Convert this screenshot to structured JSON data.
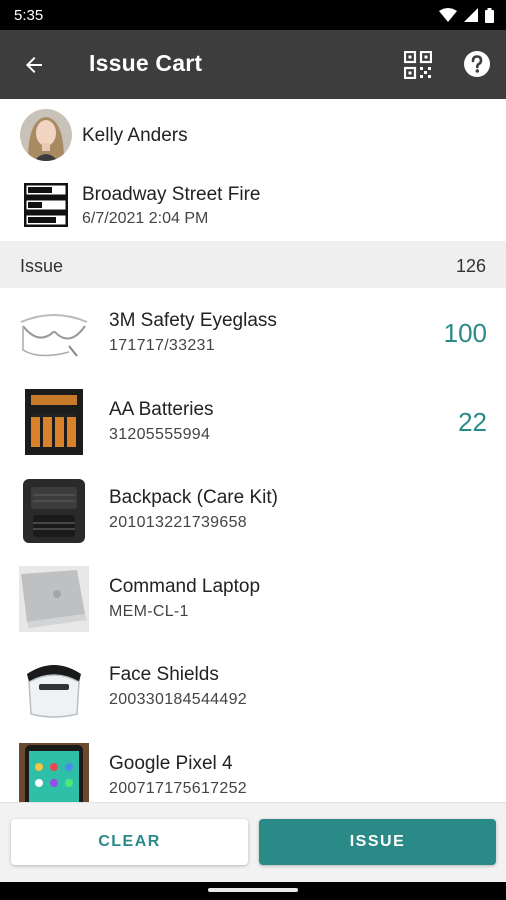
{
  "status_bar": {
    "time": "5:35",
    "icons": [
      "wifi-icon",
      "cellular-icon",
      "battery-icon"
    ]
  },
  "app_bar": {
    "title": "Issue Cart",
    "icons": [
      "back-arrow-icon",
      "qr-code-icon",
      "help-icon"
    ]
  },
  "user": {
    "name": "Kelly Anders"
  },
  "location": {
    "name": "Broadway Street Fire",
    "date": "6/7/2021 2:04 PM"
  },
  "section": {
    "label": "Issue",
    "count": "126"
  },
  "items": [
    {
      "name": "3M Safety Eyeglass",
      "code": "171717/33231",
      "qty": "100",
      "thumb": "safety-glasses-image"
    },
    {
      "name": "AA Batteries",
      "code": "31205555994",
      "qty": "22",
      "thumb": "batteries-image"
    },
    {
      "name": "Backpack (Care Kit)",
      "code": "201013221739658",
      "qty": "",
      "thumb": "backpack-image"
    },
    {
      "name": "Command Laptop",
      "code": "MEM-CL-1",
      "qty": "",
      "thumb": "laptop-image"
    },
    {
      "name": "Face Shields",
      "code": "200330184544492",
      "qty": "",
      "thumb": "face-shield-image"
    },
    {
      "name": "Google Pixel 4",
      "code": "200717175617252",
      "qty": "",
      "thumb": "phone-image"
    }
  ],
  "buttons": {
    "clear": "CLEAR",
    "issue": "ISSUE"
  },
  "colors": {
    "accent": "#2a8a87",
    "app_bar": "#3d3d3d",
    "section_bg": "#efefef"
  }
}
